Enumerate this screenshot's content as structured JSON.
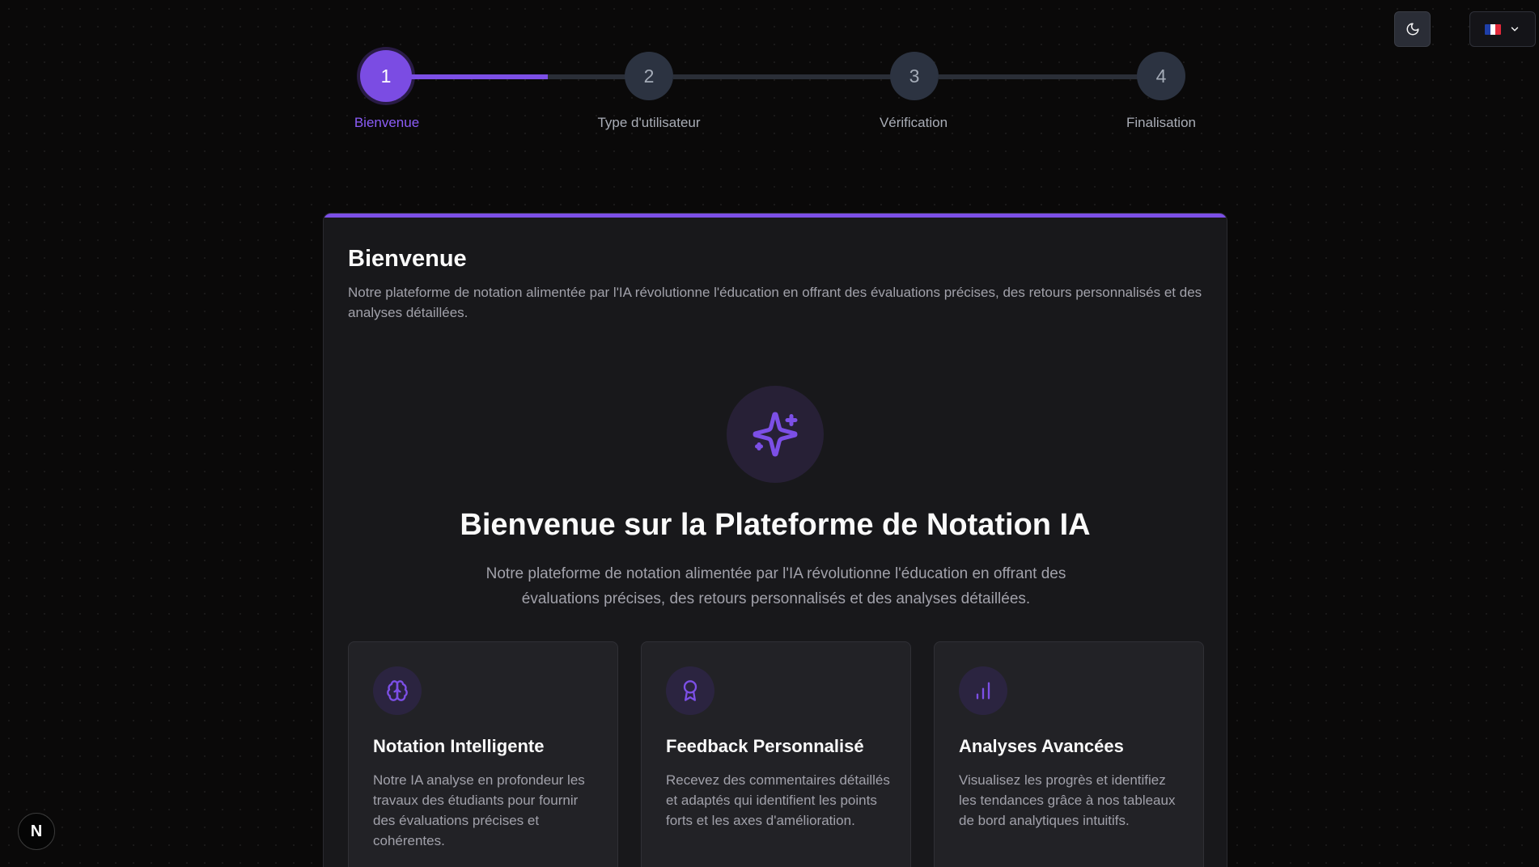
{
  "header": {
    "theme_toggle_icon": "moon-icon",
    "language": {
      "flag": "fr-flag-icon",
      "dropdown_icon": "chevron-down-icon"
    }
  },
  "stepper": {
    "current_step": 1,
    "steps": [
      {
        "number": "1",
        "label": "Bienvenue"
      },
      {
        "number": "2",
        "label": "Type d'utilisateur"
      },
      {
        "number": "3",
        "label": "Vérification"
      },
      {
        "number": "4",
        "label": "Finalisation"
      }
    ]
  },
  "card": {
    "title": "Bienvenue",
    "description": "Notre plateforme de notation alimentée par l'IA révolutionne l'éducation en offrant des évaluations précises, des retours personnalisés et des analyses détaillées.",
    "hero": {
      "icon": "sparkles-icon",
      "title": "Bienvenue sur la Plateforme de Notation IA",
      "text": "Notre plateforme de notation alimentée par l'IA révolutionne l'éducation en offrant des évaluations précises, des retours personnalisés et des analyses détaillées."
    },
    "features": [
      {
        "icon": "brain-icon",
        "title": "Notation Intelligente",
        "text": "Notre IA analyse en profondeur les travaux des étudiants pour fournir des évaluations précises et cohérentes."
      },
      {
        "icon": "award-icon",
        "title": "Feedback Personnalisé",
        "text": "Recevez des commentaires détaillés et adaptés qui identifient les points forts et les axes d'amélioration."
      },
      {
        "icon": "bar-chart-icon",
        "title": "Analyses Avancées",
        "text": "Visualisez les progrès et identifiez les tendances grâce à nos tableaux de bord analytiques intuitifs."
      }
    ]
  },
  "badge": {
    "letter": "N"
  },
  "colors": {
    "accent": "#7c4fe6",
    "background": "#0a0909",
    "card": "#18181b",
    "muted_text": "#a1a1aa"
  }
}
